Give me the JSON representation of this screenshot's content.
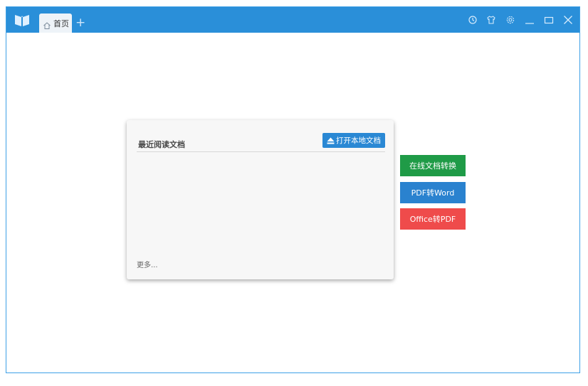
{
  "titlebar": {
    "tab_label": "首页",
    "new_tab": "+"
  },
  "card": {
    "title": "最近阅读文档",
    "open_button": "打开本地文档",
    "more_link": "更多..."
  },
  "actions": {
    "online_convert": "在线文档转换",
    "pdf_to_word": "PDF转Word",
    "office_to_pdf": "Office转PDF"
  },
  "colors": {
    "titlebar": "#2a8fd9",
    "online_convert": "#1f9b47",
    "pdf_to_word": "#2a82cf",
    "office_to_pdf": "#ef4b4b"
  }
}
